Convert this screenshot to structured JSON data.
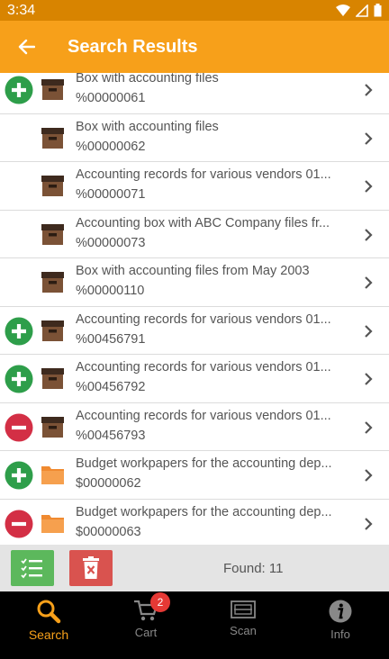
{
  "status": {
    "time": "3:34"
  },
  "header": {
    "title": "Search Results"
  },
  "items": [
    {
      "line1": "Box with accounting files",
      "line2": "%00000061",
      "action": "add",
      "icon": "box-icon"
    },
    {
      "line1": "Box with accounting files",
      "line2": "%00000062",
      "action": "none",
      "icon": "box-icon"
    },
    {
      "line1": "Accounting records for various vendors 01...",
      "line2": "%00000071",
      "action": "none",
      "icon": "box-icon"
    },
    {
      "line1": "Accounting box with ABC Company files fr...",
      "line2": "%00000073",
      "action": "none",
      "icon": "box-icon"
    },
    {
      "line1": "Box with accounting files from May 2003",
      "line2": "%00000110",
      "action": "none",
      "icon": "box-icon"
    },
    {
      "line1": "Accounting records for various vendors 01...",
      "line2": "%00456791",
      "action": "add",
      "icon": "box-icon"
    },
    {
      "line1": "Accounting records for various vendors 01...",
      "line2": "%00456792",
      "action": "add",
      "icon": "box-icon"
    },
    {
      "line1": "Accounting records for various vendors 01...",
      "line2": "%00456793",
      "action": "remove",
      "icon": "box-icon"
    },
    {
      "line1": "Budget workpapers for the accounting dep...",
      "line2": "$00000062",
      "action": "add",
      "icon": "folder-icon"
    },
    {
      "line1": "Budget workpapers for the accounting dep...",
      "line2": "$00000063",
      "action": "remove",
      "icon": "folder-icon"
    }
  ],
  "footer": {
    "found": "Found: 11"
  },
  "nav": {
    "search": "Search",
    "cart": "Cart",
    "cart_badge": "2",
    "scan": "Scan",
    "info": "Info"
  },
  "colors": {
    "accent": "#f7a01a",
    "add": "#2e9e4a",
    "remove": "#d32f45",
    "box": "#7b5236",
    "folder": "#f08a30"
  }
}
